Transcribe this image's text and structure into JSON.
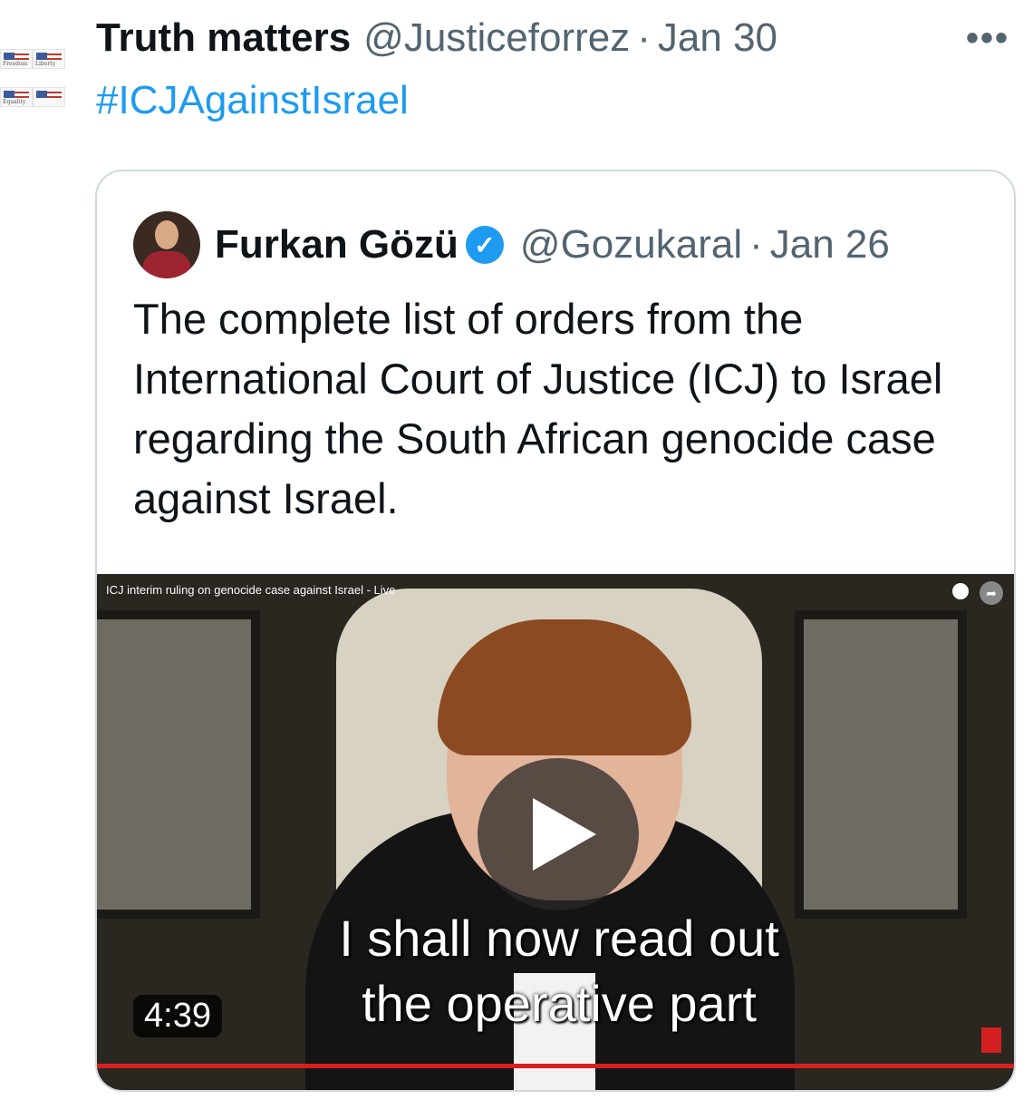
{
  "tweet": {
    "author_name": "Truth matters",
    "author_handle": "@Justiceforrez",
    "separator": "·",
    "date": "Jan 30",
    "more_label": "•••",
    "hashtag": "#ICJAgainstIsrael",
    "avatar_labels": [
      "Freedom",
      "Liberty",
      "Equality"
    ]
  },
  "quoted": {
    "author_name": "Furkan Gözü",
    "verified_mark": "✓",
    "author_handle": "@Gozukaral",
    "separator": "·",
    "date": "Jan 26",
    "text": "The complete list of orders from the International Court of Justice (ICJ) to Israel regarding the South African genocide case against Israel.",
    "video": {
      "title": "ICJ interim ruling on genocide case against Israel - Live",
      "caption_line1": "I shall now read out",
      "caption_line2": "the operative part",
      "duration": "4:39"
    }
  }
}
